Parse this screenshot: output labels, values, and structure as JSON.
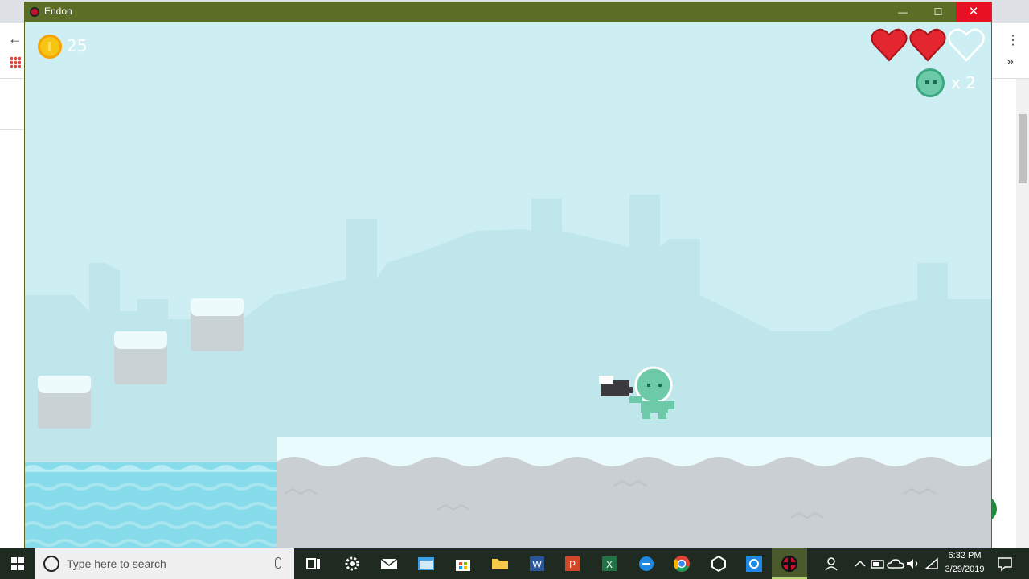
{
  "window": {
    "title": "Endon",
    "minimize": "—",
    "maximize": "☐",
    "close": "✕"
  },
  "hud": {
    "coins": "25",
    "hearts_total": 3,
    "hearts_filled": 2,
    "lives_label": "x 2"
  },
  "colors": {
    "sky": "#cdeff3",
    "heart_red": "#e3262f",
    "coin": "#f6c514",
    "player": "#6ccaa8",
    "titlebar": "#5c6d26"
  },
  "taskbar": {
    "search_placeholder": "Type here to search",
    "time": "6:32 PM",
    "date": "3/29/2019"
  },
  "background_browser": {
    "back_glyph": "←",
    "more_glyph": "⋮",
    "chevron_glyph": "»"
  }
}
